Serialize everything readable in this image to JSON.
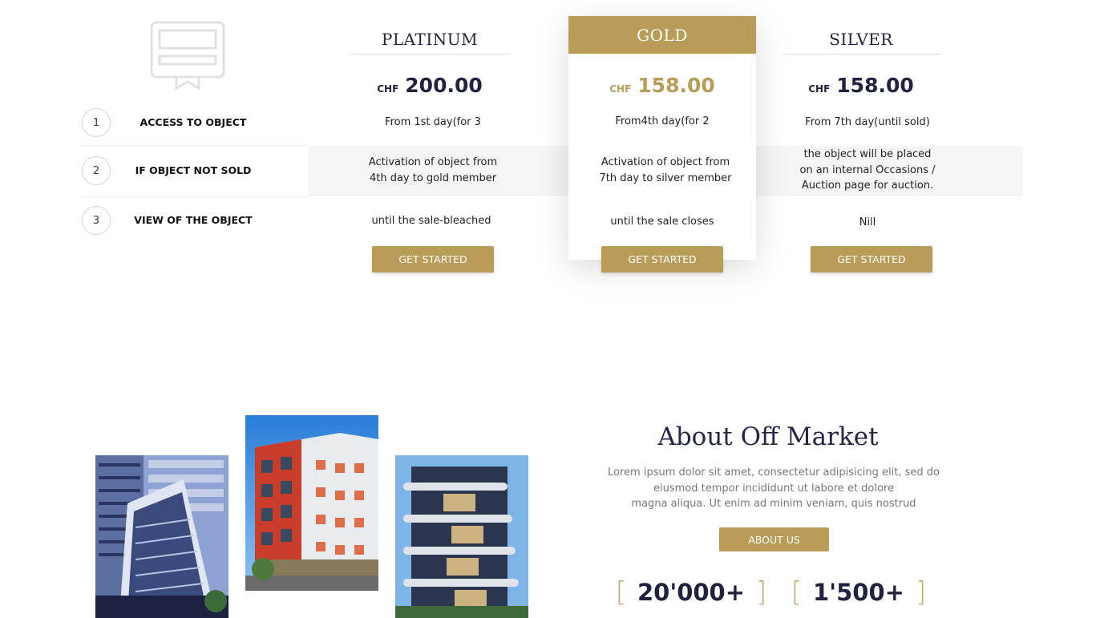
{
  "plans": {
    "platinum": {
      "name": "PLATINUM",
      "currency": "CHF",
      "price": "200.00"
    },
    "gold": {
      "name": "GOLD",
      "currency": "CHF",
      "price": "158.00"
    },
    "silver": {
      "name": "SILVER",
      "currency": "CHF",
      "price": "158.00"
    }
  },
  "rows": [
    {
      "number": "1",
      "label": "ACCESS TO OBJECT",
      "platinum": "From 1st day(for 3",
      "gold": "From4th  day(for 2",
      "silver": "From 7th day(until sold)"
    },
    {
      "number": "2",
      "label": "IF OBJECT NOT SOLD",
      "platinum_l1": "Activation of object from",
      "platinum_l2": "4th day to gold member",
      "gold_l1": "Activation of object from",
      "gold_l2": "7th day to silver member",
      "silver_l1": "the object will be placed",
      "silver_l2": "on an internal Occasions /",
      "silver_l3": "Auction page for auction."
    },
    {
      "number": "3",
      "label": "VIEW OF THE OBJECT",
      "platinum": "until the sale-bleached",
      "gold": "until the sale closes",
      "silver": "Nill"
    }
  ],
  "cta": {
    "get_started": "GET STARTED"
  },
  "about": {
    "title": "About Off Market",
    "line1": "Lorem ipsum dolor sit amet, consectetur adipisicing elit, sed do",
    "line2": "eiusmod tempor incididunt ut labore et dolore",
    "line3": "magna aliqua. Ut enim ad minim veniam, quis nostrud",
    "button": "ABOUT US"
  },
  "stats": [
    {
      "value": "20'000+"
    },
    {
      "value": "1'500+"
    }
  ],
  "icons": {
    "header_icon": "certificate-icon"
  },
  "colors": {
    "accent": "#b89c58",
    "navy": "#1f2240"
  }
}
